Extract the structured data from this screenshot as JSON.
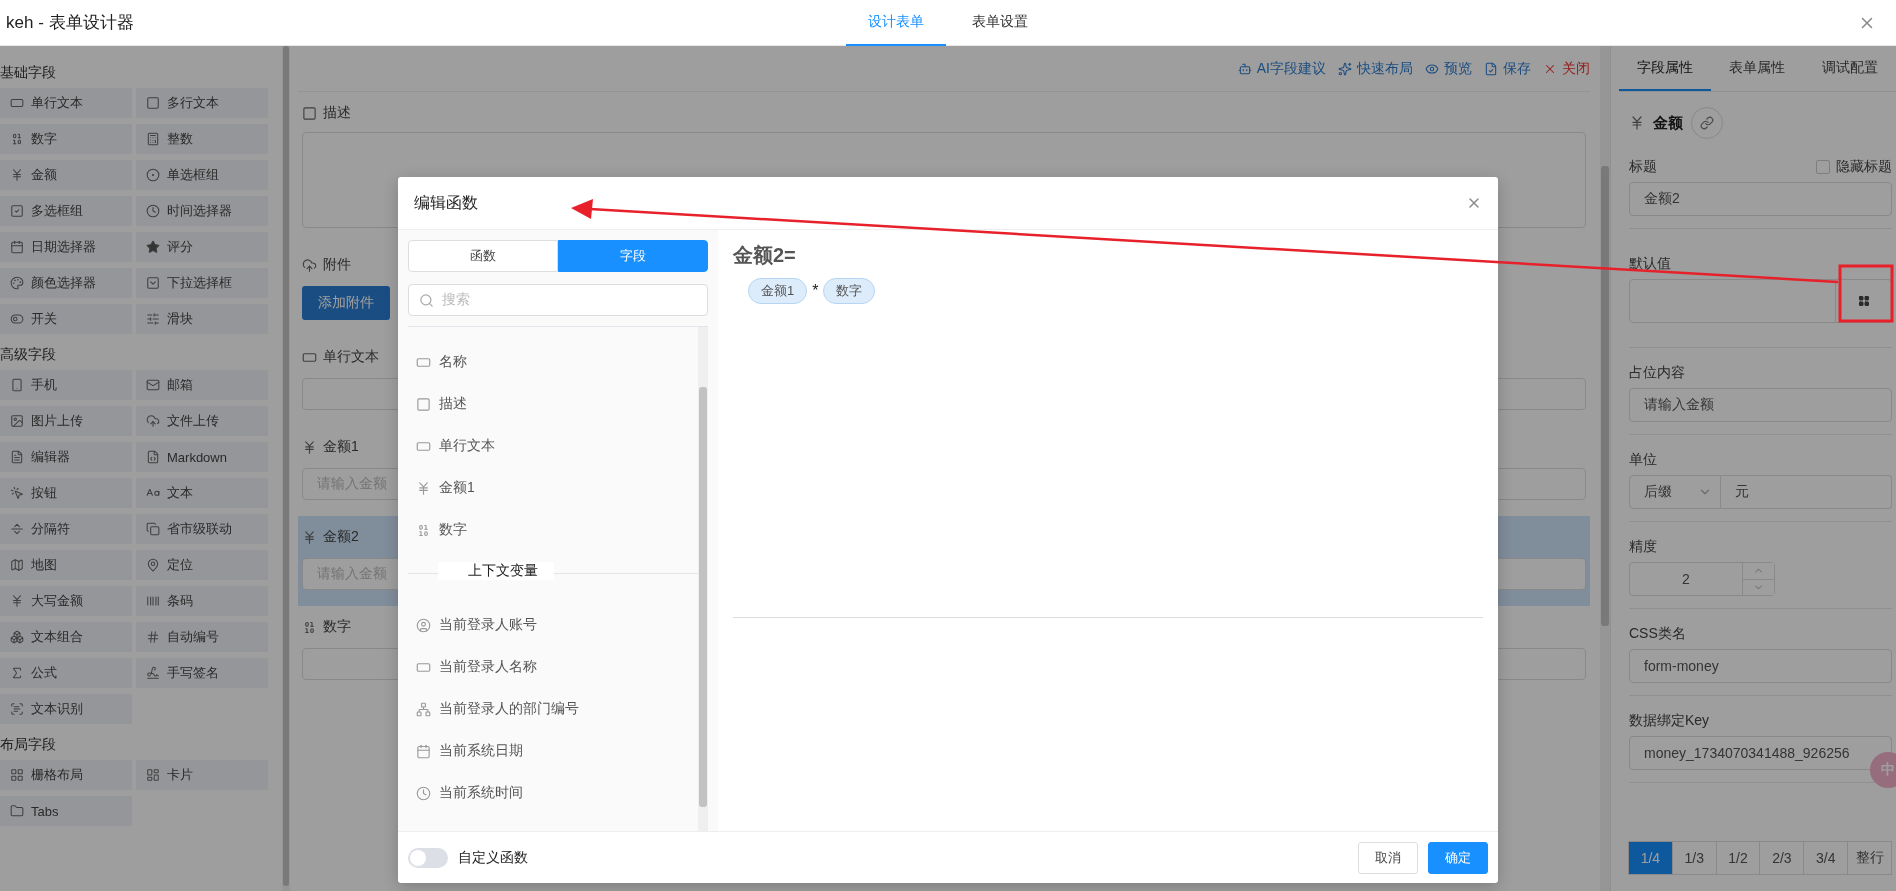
{
  "header": {
    "title": "keh - 表单设计器",
    "tabs": [
      {
        "label": "设计表单",
        "selected": true
      },
      {
        "label": "表单设置",
        "selected": false
      }
    ]
  },
  "palette": {
    "groups": [
      {
        "title": "基础字段",
        "items": [
          {
            "label": "单行文本",
            "kind": "input"
          },
          {
            "label": "多行文本",
            "kind": "textarea"
          },
          {
            "label": "数字",
            "kind": "number"
          },
          {
            "label": "整数",
            "kind": "integer"
          },
          {
            "label": "金额",
            "kind": "money"
          },
          {
            "label": "单选框组",
            "kind": "radio"
          },
          {
            "label": "多选框组",
            "kind": "checkbox"
          },
          {
            "label": "时间选择器",
            "kind": "time"
          },
          {
            "label": "日期选择器",
            "kind": "date"
          },
          {
            "label": "评分",
            "kind": "star"
          },
          {
            "label": "颜色选择器",
            "kind": "color"
          },
          {
            "label": "下拉选择框",
            "kind": "select"
          },
          {
            "label": "开关",
            "kind": "switch"
          },
          {
            "label": "滑块",
            "kind": "slider"
          }
        ]
      },
      {
        "title": "高级字段",
        "items": [
          {
            "label": "手机",
            "kind": "phone"
          },
          {
            "label": "邮箱",
            "kind": "mail"
          },
          {
            "label": "图片上传",
            "kind": "image"
          },
          {
            "label": "文件上传",
            "kind": "cloud"
          },
          {
            "label": "编辑器",
            "kind": "editor"
          },
          {
            "label": "Markdown",
            "kind": "markdown"
          },
          {
            "label": "按钮",
            "kind": "button"
          },
          {
            "label": "文本",
            "kind": "text"
          },
          {
            "label": "分隔符",
            "kind": "divider"
          },
          {
            "label": "省市级联动",
            "kind": "cascade"
          },
          {
            "label": "地图",
            "kind": "map"
          },
          {
            "label": "定位",
            "kind": "pin"
          },
          {
            "label": "大写金额",
            "kind": "money"
          },
          {
            "label": "条码",
            "kind": "barcode"
          },
          {
            "label": "文本组合",
            "kind": "group"
          },
          {
            "label": "自动编号",
            "kind": "hash"
          },
          {
            "label": "公式",
            "kind": "formula"
          },
          {
            "label": "手写签名",
            "kind": "signature"
          },
          {
            "label": "文本识别",
            "kind": "ocr"
          }
        ]
      },
      {
        "title": "布局字段",
        "items": [
          {
            "label": "栅格布局",
            "kind": "grid"
          },
          {
            "label": "卡片",
            "kind": "card"
          },
          {
            "label": "Tabs",
            "kind": "tabs"
          }
        ]
      }
    ]
  },
  "toolbar": [
    {
      "label": "AI字段建议",
      "kind": "robot"
    },
    {
      "label": "快速布局",
      "kind": "sparkle"
    },
    {
      "label": "预览",
      "kind": "eye"
    },
    {
      "label": "保存",
      "kind": "file"
    },
    {
      "label": "关闭",
      "kind": "close"
    }
  ],
  "canvas_fields": [
    {
      "label": "描述",
      "kind": "textarea",
      "selected": false
    },
    {
      "label": "附件",
      "kind": "upload",
      "button": "添加附件",
      "selected": false
    },
    {
      "label": "单行文本",
      "kind": "input",
      "selected": false
    },
    {
      "label": "金额1",
      "kind": "money",
      "placeholder": "请输入金额",
      "selected": false
    },
    {
      "label": "金额2",
      "kind": "money",
      "placeholder": "请输入金额",
      "selected": true
    },
    {
      "label": "数字",
      "kind": "number",
      "selected": false
    }
  ],
  "properties": {
    "tabs": [
      {
        "label": "字段属性",
        "selected": true
      },
      {
        "label": "表单属性",
        "selected": false
      },
      {
        "label": "调试配置",
        "selected": false
      }
    ],
    "field_type": "金额",
    "title_label": "标题",
    "hide_title": {
      "label": "隐藏标题",
      "checked": false
    },
    "title_value": "金额2",
    "default_label": "默认值",
    "placeholder_label": "占位内容",
    "placeholder_value": "请输入金额",
    "unit_label": "单位",
    "unit_position": "后缀",
    "unit_value": "元",
    "precision_label": "精度",
    "precision_value": "2",
    "css_label": "CSS类名",
    "css_value": "form-money",
    "key_label": "数据绑定Key",
    "key_value": "money_1734070341488_926256",
    "widths": [
      {
        "label": "1/4",
        "selected": true
      },
      {
        "label": "1/3",
        "selected": false
      },
      {
        "label": "1/2",
        "selected": false
      },
      {
        "label": "2/3",
        "selected": false
      },
      {
        "label": "3/4",
        "selected": false
      },
      {
        "label": "整行",
        "selected": false
      }
    ]
  },
  "floating_badge": "中",
  "modal": {
    "title": "编辑函数",
    "tabs": [
      {
        "label": "函数",
        "selected": false
      },
      {
        "label": "字段",
        "selected": true
      }
    ],
    "search_placeholder": "搜索",
    "sections": [
      {
        "items": [
          {
            "label": "名称",
            "kind": "input"
          },
          {
            "label": "描述",
            "kind": "textarea"
          },
          {
            "label": "单行文本",
            "kind": "input"
          },
          {
            "label": "金额1",
            "kind": "money"
          },
          {
            "label": "数字",
            "kind": "number"
          }
        ]
      },
      {
        "title": "上下文变量",
        "items": [
          {
            "label": "当前登录人账号",
            "kind": "user"
          },
          {
            "label": "当前登录人名称",
            "kind": "input"
          },
          {
            "label": "当前登录人的部门编号",
            "kind": "org"
          },
          {
            "label": "当前系统日期",
            "kind": "date"
          },
          {
            "label": "当前系统时间",
            "kind": "time"
          }
        ]
      }
    ],
    "formula_target": "金额2=",
    "formula": [
      {
        "kind": "field",
        "text": "金额1"
      },
      {
        "kind": "operator",
        "text": "*"
      },
      {
        "kind": "field",
        "text": "数字"
      }
    ],
    "custom_toggle": {
      "label": "自定义函数",
      "on": false
    },
    "buttons": [
      {
        "label": "取消",
        "kind": "default"
      },
      {
        "label": "确定",
        "kind": "primary"
      }
    ]
  }
}
